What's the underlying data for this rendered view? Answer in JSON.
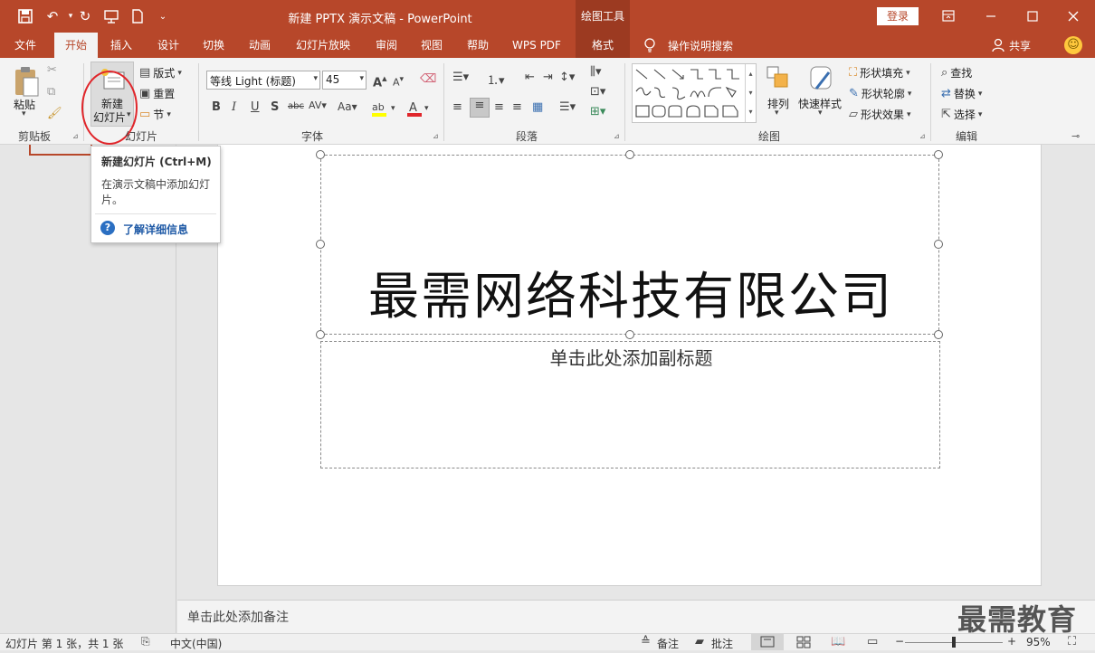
{
  "app": {
    "title": "新建 PPTX 演示文稿  -  PowerPoint",
    "contextual_group": "绘图工具",
    "login_label": "登录"
  },
  "tabs": [
    "文件",
    "开始",
    "插入",
    "设计",
    "切换",
    "动画",
    "幻灯片放映",
    "审阅",
    "视图",
    "帮助",
    "WPS PDF",
    "格式"
  ],
  "tell_me": "操作说明搜索",
  "share": "共享",
  "ribbon": {
    "clipboard": {
      "label": "剪贴板",
      "paste": "粘贴"
    },
    "slides": {
      "label": "幻灯片",
      "new_slide_line1": "新建",
      "new_slide_line2": "幻灯片",
      "layout": "版式",
      "reset": "重置",
      "section": "节"
    },
    "font": {
      "label": "字体",
      "font_name": "等线 Light (标题)",
      "font_size": "45"
    },
    "paragraph": {
      "label": "段落"
    },
    "drawing": {
      "label": "绘图",
      "arrange": "排列",
      "quick_styles": "快速样式",
      "shape_fill": "形状填充",
      "shape_outline": "形状轮廓",
      "shape_effects": "形状效果"
    },
    "editing": {
      "label": "编辑",
      "find": "查找",
      "replace": "替换",
      "select": "选择"
    }
  },
  "tooltip": {
    "title": "新建幻灯片 (Ctrl+M)",
    "description": "在演示文稿中添加幻灯片。",
    "link": "了解详细信息"
  },
  "slide": {
    "title": "最需网络科技有限公司",
    "subtitle_placeholder": "单击此处添加副标题"
  },
  "notes_placeholder": "单击此处添加备注",
  "status": {
    "slide_info": "幻灯片 第 1 张，共 1 张",
    "language": "中文(中国)",
    "notes": "备注",
    "comments": "批注",
    "zoom": "95%"
  },
  "watermark": "最需教育",
  "colors": {
    "accent": "#b7472a",
    "highlight_circle": "#e0262b"
  }
}
